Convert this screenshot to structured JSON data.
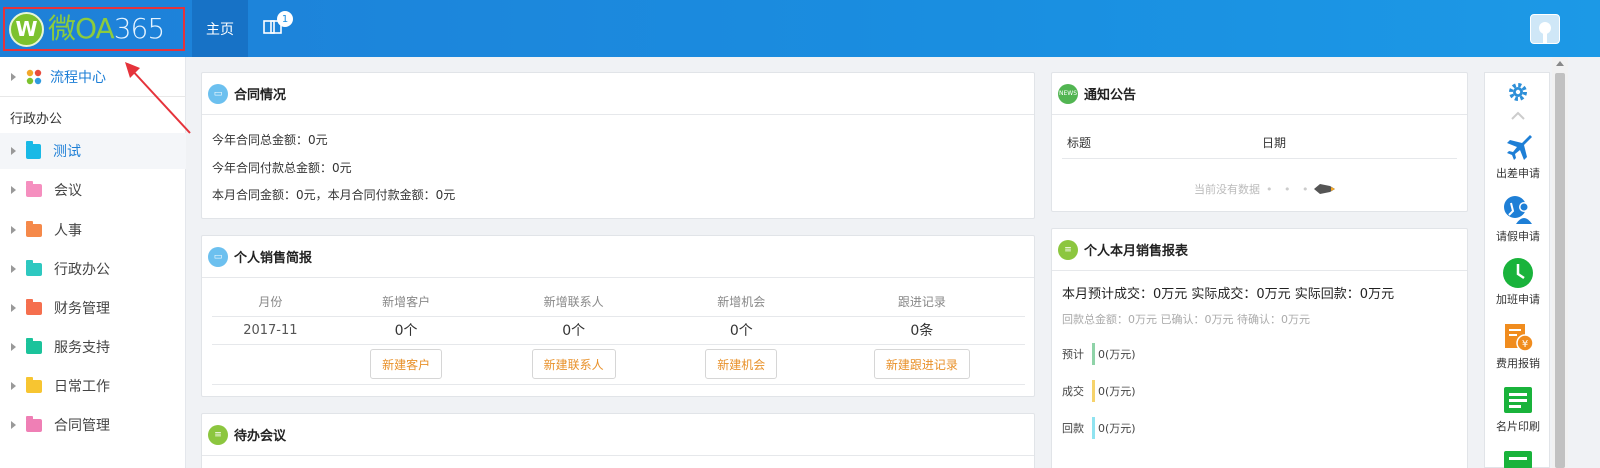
{
  "header": {
    "logo_mark": "W",
    "logo_text_a": "微OA",
    "logo_text_b": "365",
    "nav_home": "主页",
    "message_badge": "1"
  },
  "sidebar": {
    "top_item": "流程中心",
    "group_title": "行政办公",
    "items": [
      {
        "label": "测试",
        "color": "#19b9e6"
      },
      {
        "label": "会议",
        "color": "#f58fbf"
      },
      {
        "label": "人事",
        "color": "#f5894a"
      },
      {
        "label": "行政办公",
        "color": "#2ec8c0"
      },
      {
        "label": "财务管理",
        "color": "#f56f4e"
      },
      {
        "label": "服务支持",
        "color": "#1bc39b"
      },
      {
        "label": "日常工作",
        "color": "#f7c531"
      },
      {
        "label": "合同管理",
        "color": "#ef7fb5"
      }
    ]
  },
  "contract": {
    "title": "合同情况",
    "line1": "今年合同总金额：0元",
    "line2": "今年合同付款总金额：0元",
    "line3": "本月合同金额：0元，本月合同付款金额：0元"
  },
  "sales_brief": {
    "title": "个人销售简报",
    "headers": [
      "月份",
      "新增客户",
      "新增联系人",
      "新增机会",
      "跟进记录"
    ],
    "row": [
      "2017-11",
      "0个",
      "0个",
      "0个",
      "0条"
    ],
    "buttons": [
      "新建客户",
      "新建联系人",
      "新建机会",
      "新建跟进记录"
    ]
  },
  "meetings": {
    "title": "待办会议"
  },
  "notice": {
    "title": "通知公告",
    "col_title": "标题",
    "col_date": "日期",
    "empty": "当前没有数据"
  },
  "report": {
    "title": "个人本月销售报表",
    "summary": "本月预计成交：0万元   实际成交：0万元   实际回款：0万元",
    "sub": "回款总金额：0万元   已确认：0万元   待确认：0万元",
    "rows": [
      {
        "label": "预计",
        "value": "0(万元)",
        "color": "#8fd3a8"
      },
      {
        "label": "成交",
        "value": "0(万元)",
        "color": "#f6d36b"
      },
      {
        "label": "回款",
        "value": "0(万元)",
        "color": "#8fe3f0"
      }
    ]
  },
  "quick": {
    "items": [
      "出差申请",
      "请假申请",
      "加班申请",
      "费用报销",
      "名片印刷"
    ]
  }
}
